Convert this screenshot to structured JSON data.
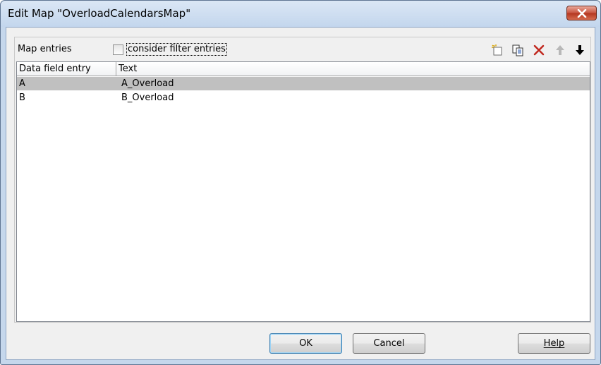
{
  "window": {
    "title": "Edit Map \"OverloadCalendarsMap\""
  },
  "map_entries": {
    "label": "Map entries",
    "consider_filter_label": "consider filter entries",
    "consider_filter_checked": false
  },
  "toolbar": {
    "icons": [
      "new-entry-icon",
      "copy-icon",
      "delete-icon",
      "move-up-icon",
      "move-down-icon"
    ]
  },
  "table": {
    "columns": [
      "Data field entry",
      "Text"
    ],
    "rows": [
      {
        "data_field_entry": "A",
        "text": "A_Overload",
        "selected": true
      },
      {
        "data_field_entry": "B",
        "text": "B_Overload",
        "selected": false
      }
    ]
  },
  "buttons": {
    "ok": "OK",
    "cancel": "Cancel",
    "help": "Help"
  },
  "colors": {
    "selection": "#c0c0c0",
    "close_button": "#c7533e",
    "delete_icon": "#c0261c"
  }
}
